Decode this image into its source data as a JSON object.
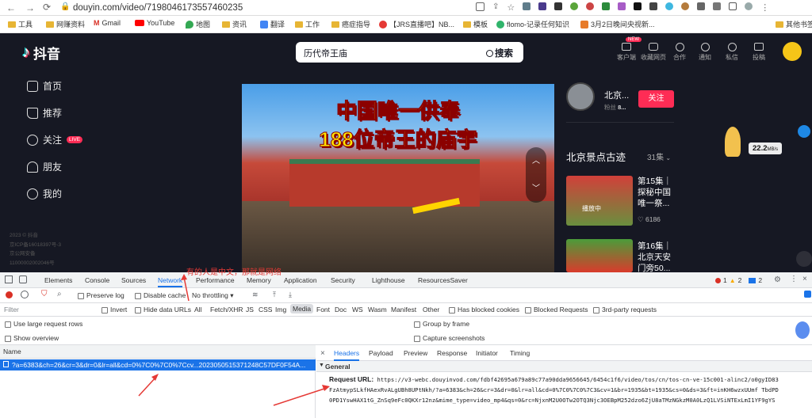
{
  "browser": {
    "url": "douyin.com/video/7198046173557460235",
    "bookmarks": [
      "工具",
      "网赚资料",
      "Gmail",
      "YouTube",
      "地图",
      "资讯",
      "翻译",
      "工作",
      "癌症指导",
      "【JRS直播吧】NB...",
      "模板",
      "flomo-记录任何知识",
      "3月2日晚间央视新...",
      "其他书签"
    ]
  },
  "site": {
    "logo_text": "抖音",
    "search_value": "历代帝王庙",
    "search_button": "搜索",
    "nav": [
      "首页",
      "推荐",
      "关注",
      "朋友",
      "我的"
    ],
    "live_badge": "LIVE",
    "footer": [
      "2023 © 抖音",
      "京ICP备16018397号-3",
      "京公网安备",
      "11000002002046号"
    ],
    "header_actions": [
      "客户端",
      "收藏网页",
      "合作",
      "通知",
      "私信",
      "投稿"
    ],
    "new_badge": "NEW"
  },
  "video": {
    "title_line1": "中国唯一供奉",
    "title_line2": "188位帝王的庙宇"
  },
  "author": {
    "name": "北京...",
    "fans_label": "粉丝",
    "fans_value": "8...",
    "follow_button": "关注"
  },
  "collection": {
    "title": "北京景点古迹",
    "count": "31集",
    "items": [
      {
        "title": "第15集｜探秘中国唯一祭...",
        "badge": "播放中",
        "likes": "6186"
      },
      {
        "title": "第16集｜北京天安门旁50...",
        "badge": "",
        "likes": ""
      }
    ]
  },
  "widget": {
    "speed": "22.2",
    "unit": "MB/s"
  },
  "annotation": {
    "text": "有的人是中文，那就是网络"
  },
  "devtools": {
    "tabs": [
      "Elements",
      "Console",
      "Sources",
      "Network",
      "Performance",
      "Memory",
      "Application",
      "Security",
      "Lighthouse",
      "ResourcesSaver"
    ],
    "active_tab": "Network",
    "errors": "1",
    "warnings": "2",
    "messages": "2",
    "toolbar": {
      "preserve_log": "Preserve log",
      "disable_cache": "Disable cache",
      "throttle": "No throttling"
    },
    "filter_placeholder": "Filter",
    "filter_options": [
      "Invert",
      "Hide data URLs",
      "All",
      "Fetch/XHR",
      "JS",
      "CSS",
      "Img",
      "Media",
      "Font",
      "Doc",
      "WS",
      "Wasm",
      "Manifest",
      "Other",
      "Has blocked cookies",
      "Blocked Requests",
      "3rd-party requests"
    ],
    "active_filter": "Media",
    "settings": [
      "Use large request rows",
      "Show overview",
      "Group by frame",
      "Capture screenshots"
    ],
    "list_header": "Name",
    "request_row": "?a=6383&ch=26&cr=3&dr=0&lr=all&cd=0%7C0%7C0%7Ccv...2023050515371248C57DF0F54A...",
    "detail_tabs": [
      "Headers",
      "Payload",
      "Preview",
      "Response",
      "Initiator",
      "Timing"
    ],
    "active_detail_tab": "Headers",
    "general_label": "General",
    "request_url_label": "Request URL:",
    "request_url_line1": "https://v3-webc.douyinvod.com/fdbf42695a679a89c77a90dda9656645/6454c1f6/video/tos/cn/tos-cn-ve-15c001-alinc2/o0gyID83",
    "request_url_line2": "FzAtmypSLkfHAexRvALgUBh8UPtNkh/?a=6383&ch=26&cr=3&dr=0&lr=all&cd=0%7C0%7C0%7C3&cv=1&br=1935&bt=1935&cs=0&ds=3&ft=inKH6wzxUUmf TbdPD",
    "request_url_line3": "0PD1YswHAX1tG_ZnSq9eFc0QKXr12nz&mime_type=video_mp4&qs=0&rc=NjxnM2U0OTw2OTQ3Njc3OEBpM252dzo6ZjU8aTMzNGkzM0A0LzQ1LVSiNTExLmI1YF9gYS"
  },
  "colors": {
    "accent": "#fe2c55",
    "page_bg": "#161823",
    "devtools_blue": "#1a73e8",
    "annotation_red": "#e53935"
  }
}
